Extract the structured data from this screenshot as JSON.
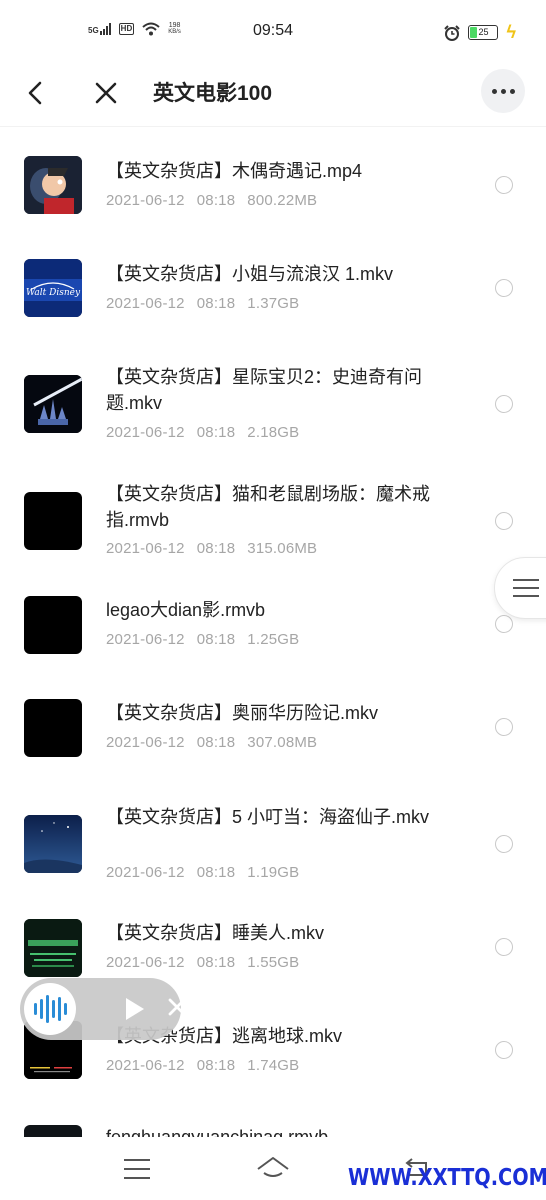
{
  "status_bar": {
    "network": "5G",
    "hd": "HD",
    "speed_value": "198",
    "speed_unit": "KB/s",
    "time": "09:54",
    "battery": "25"
  },
  "header": {
    "title": "英文电影100"
  },
  "files": [
    {
      "name": "【英文杂货店】木偶奇遇记.mp4",
      "date": "2021-06-12",
      "time": "08:18",
      "size": "800.22MB",
      "thumb": "pinocchio"
    },
    {
      "name": "【英文杂货店】小姐与流浪汉 1.mkv",
      "date": "2021-06-12",
      "time": "08:18",
      "size": "1.37GB",
      "thumb": "walt-disney-logo"
    },
    {
      "name": "【英文杂货店】星际宝贝2：史迪奇有问题.mkv",
      "date": "2021-06-12",
      "time": "08:18",
      "size": "2.18GB",
      "thumb": "disney-castle"
    },
    {
      "name": "【英文杂货店】猫和老鼠剧场版：魔术戒指.rmvb",
      "date": "2021-06-12",
      "time": "08:18",
      "size": "315.06MB",
      "thumb": "black"
    },
    {
      "name": "legao大dian影.rmvb",
      "date": "2021-06-12",
      "time": "08:18",
      "size": "1.25GB",
      "thumb": "black"
    },
    {
      "name": "【英文杂货店】奥丽华历险记.mkv",
      "date": "2021-06-12",
      "time": "08:18",
      "size": "307.08MB",
      "thumb": "black"
    },
    {
      "name": "【英文杂货店】5 小叮当：海盗仙子.mkv",
      "date": "2021-06-12",
      "time": "08:18",
      "size": "1.19GB",
      "thumb": "night-sky"
    },
    {
      "name": "【英文杂货店】睡美人.mkv",
      "date": "2021-06-12",
      "time": "08:18",
      "size": "1.55GB",
      "thumb": "green-title"
    },
    {
      "name": "【英文杂货店】逃离地球.mkv",
      "date": "2021-06-12",
      "time": "08:18",
      "size": "1.74GB",
      "thumb": "black-text"
    }
  ],
  "partial_item_name": "fenghuangyuanchinag.rmvb",
  "watermark": "WWW.XXTTQ.COM",
  "colors": {
    "watermark": "#1a2fd6",
    "audio_accent": "#2a8cd6",
    "meta_text": "#a6a6a6",
    "battery_fill": "#4cd964"
  }
}
